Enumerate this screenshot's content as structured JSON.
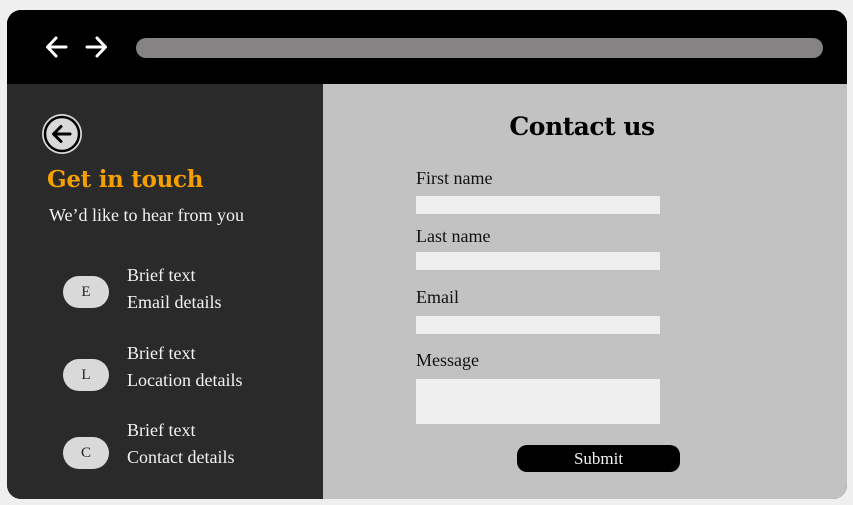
{
  "browser": {
    "back_icon": "arrow-left-icon",
    "forward_icon": "arrow-right-icon"
  },
  "sidebar": {
    "back_icon": "circle-arrow-left-icon",
    "heading": "Get in touch",
    "subtitle": "We’d like to hear from you",
    "items": [
      {
        "badge": "E",
        "line1": "Brief text",
        "line2": "Email details"
      },
      {
        "badge": "L",
        "line1": "Brief text",
        "line2": "Location details"
      },
      {
        "badge": "C",
        "line1": "Brief text",
        "line2": "Contact details"
      }
    ]
  },
  "form": {
    "title": "Contact us",
    "first_name_label": "First name",
    "last_name_label": "Last name",
    "email_label": "Email",
    "message_label": "Message",
    "submit_label": "Submit"
  },
  "colors": {
    "accent": "#f5a000",
    "sidebar_bg": "#2a2a2a",
    "form_bg": "#c2c2c2"
  }
}
